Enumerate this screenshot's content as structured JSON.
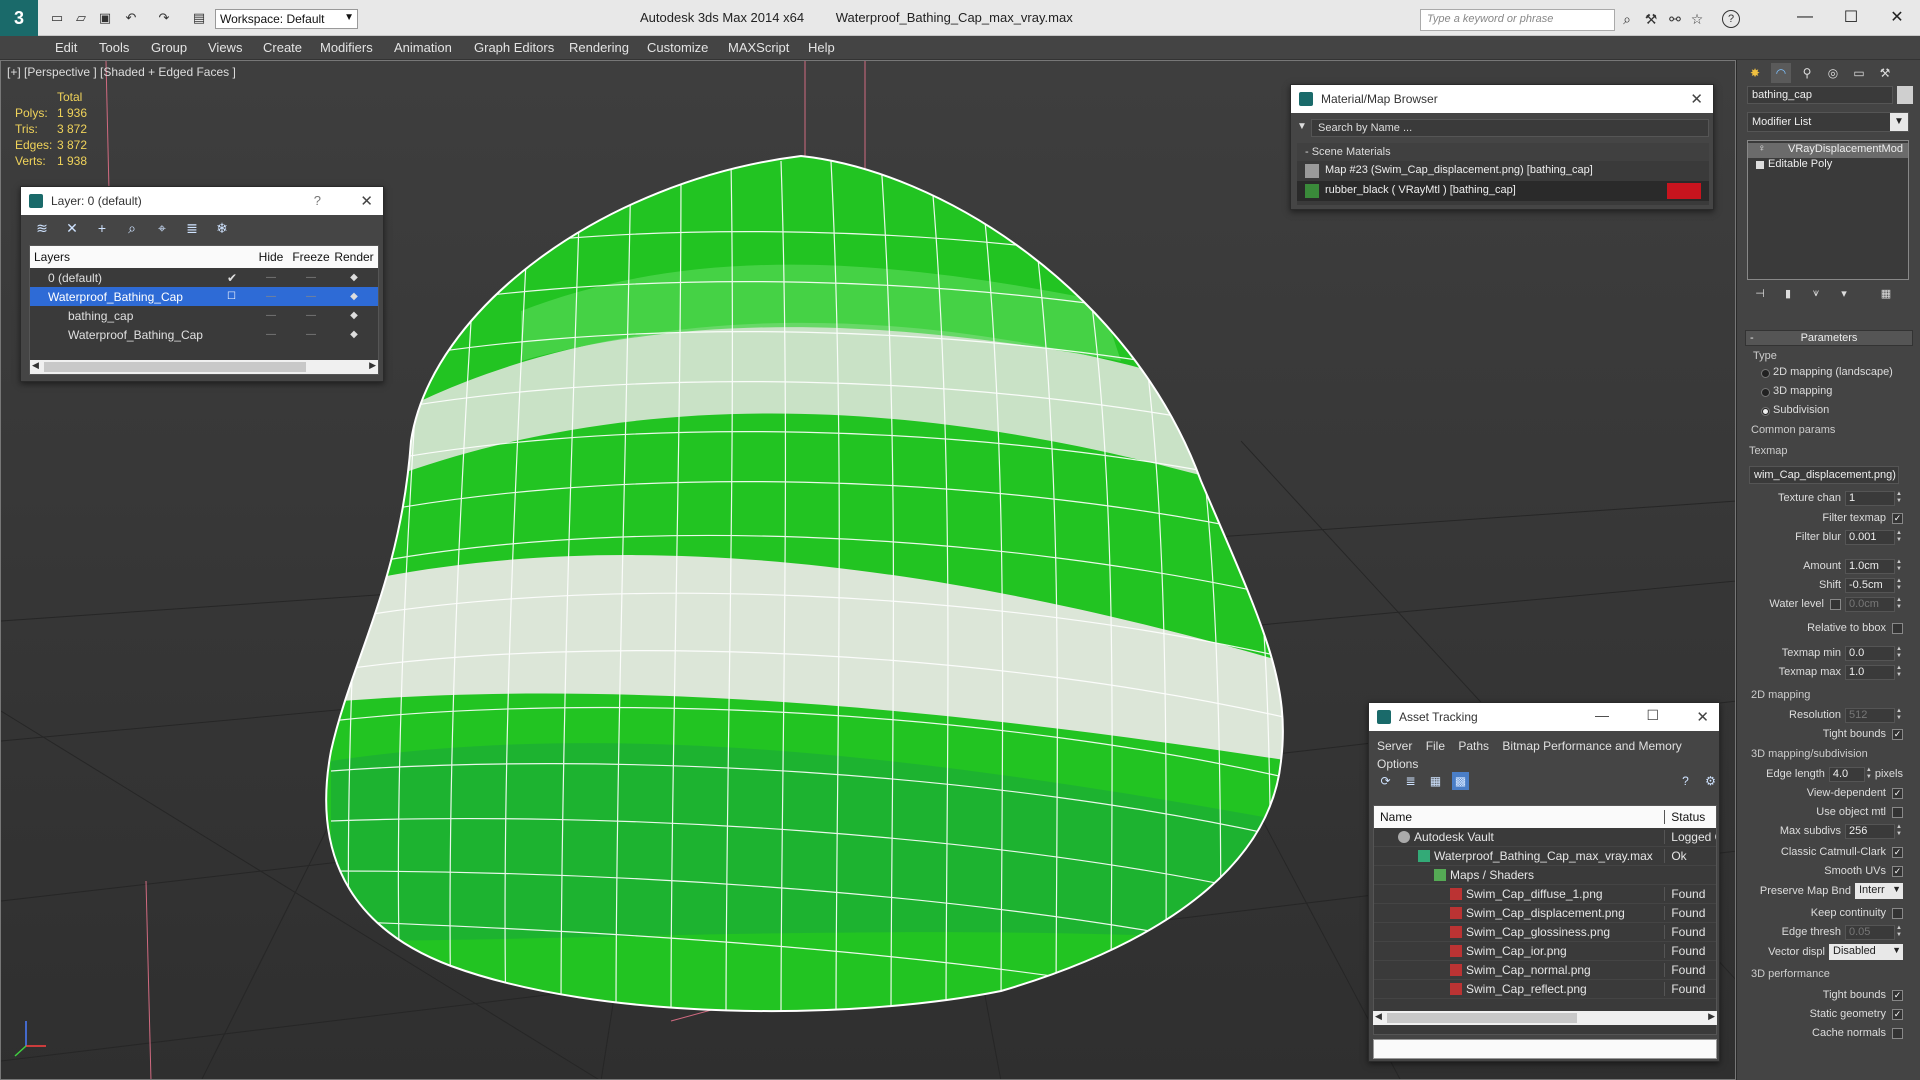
{
  "title_bar": {
    "app_name": "Autodesk 3ds Max  2014 x64",
    "file_name": "Waterproof_Bathing_Cap_max_vray.max",
    "workspace_label": "Workspace: Default",
    "search_placeholder": "Type a keyword or phrase",
    "help_label": "?"
  },
  "menu": [
    "Edit",
    "Tools",
    "Group",
    "Views",
    "Create",
    "Modifiers",
    "Animation",
    "Graph Editors",
    "Rendering",
    "Customize",
    "MAXScript",
    "Help"
  ],
  "viewport": {
    "label": "[+] [Perspective ] [Shaded + Edged Faces ]",
    "stats": {
      "header": "Total",
      "rows": [
        {
          "k": "Polys:",
          "v": "1 936"
        },
        {
          "k": "Tris:",
          "v": "3 872"
        },
        {
          "k": "Edges:",
          "v": "3 872"
        },
        {
          "k": "Verts:",
          "v": "1 938"
        }
      ]
    },
    "cap_colors": {
      "green": "#22cc22",
      "white": "#dde8dd",
      "wire": "#ffffff"
    }
  },
  "layer_panel": {
    "title": "Layer: 0 (default)",
    "help": "?",
    "columns": [
      "Layers",
      "Hide",
      "Freeze",
      "Render"
    ],
    "rows": [
      {
        "name": "0 (default)",
        "current": "✔"
      },
      {
        "name": "Waterproof_Bathing_Cap",
        "current": ""
      },
      {
        "name": "bathing_cap",
        "current": ""
      },
      {
        "name": "Waterproof_Bathing_Cap",
        "current": ""
      }
    ]
  },
  "material_browser": {
    "title": "Material/Map Browser",
    "search_placeholder": "Search by Name ...",
    "group": "- Scene Materials",
    "items": [
      "Map #23 (Swim_Cap_displacement.png)  [bathing_cap]",
      "rubber_black  ( VRayMtl )  [bathing_cap]"
    ]
  },
  "asset_tracking": {
    "title": "Asset Tracking",
    "menu_row1": [
      "Server",
      "File",
      "Paths",
      "Bitmap Performance and Memory"
    ],
    "menu_row2": [
      "Options"
    ],
    "columns": [
      "Name",
      "Status"
    ],
    "rows": [
      {
        "name": "Autodesk Vault",
        "status": "Logged C",
        "icon": "vault"
      },
      {
        "name": "Waterproof_Bathing_Cap_max_vray.max",
        "status": "Ok",
        "icon": "max"
      },
      {
        "name": "Maps / Shaders",
        "status": "",
        "icon": "folder"
      },
      {
        "name": "Swim_Cap_diffuse_1.png",
        "status": "Found",
        "icon": "png"
      },
      {
        "name": "Swim_Cap_displacement.png",
        "status": "Found",
        "icon": "png"
      },
      {
        "name": "Swim_Cap_glossiness.png",
        "status": "Found",
        "icon": "png"
      },
      {
        "name": "Swim_Cap_ior.png",
        "status": "Found",
        "icon": "png"
      },
      {
        "name": "Swim_Cap_normal.png",
        "status": "Found",
        "icon": "png"
      },
      {
        "name": "Swim_Cap_reflect.png",
        "status": "Found",
        "icon": "png"
      }
    ]
  },
  "command_panel": {
    "object_name": "bathing_cap",
    "modifier_list": "Modifier List",
    "stack": [
      "VRayDisplacementMod",
      "Editable Poly"
    ],
    "parameters_title": "Parameters",
    "type_label": "Type",
    "type_options": [
      "2D mapping (landscape)",
      "3D mapping",
      "Subdivision"
    ],
    "common_params": "Common params",
    "texmap_label": "Texmap",
    "texmap_value": "wim_Cap_displacement.png)",
    "texture_chan_label": "Texture chan",
    "texture_chan_value": "1",
    "filter_texmap_label": "Filter texmap",
    "filter_blur_label": "Filter blur",
    "filter_blur_value": "0.001",
    "amount_label": "Amount",
    "amount_value": "1.0cm",
    "shift_label": "Shift",
    "shift_value": "-0.5cm",
    "water_level_label": "Water level",
    "water_level_value": "0.0cm",
    "relative_bbox_label": "Relative to bbox",
    "texmap_min_label": "Texmap min",
    "texmap_min_value": "0.0",
    "texmap_max_label": "Texmap max",
    "texmap_max_value": "1.0",
    "mapping2d_title": "2D mapping",
    "resolution_label": "Resolution",
    "resolution_value": "512",
    "tight_bounds_label": "Tight bounds",
    "mapping3d_title": "3D mapping/subdivision",
    "edge_length_label": "Edge length",
    "edge_length_value": "4.0",
    "pixels_label": "pixels",
    "view_dependent_label": "View-dependent",
    "use_object_mtl_label": "Use object mtl",
    "max_subdivs_label": "Max subdivs",
    "max_subdivs_value": "256",
    "catmull_label": "Classic Catmull-Clark",
    "smooth_uvs_label": "Smooth UVs",
    "preserve_map_label": "Preserve Map Bnd",
    "preserve_map_value": "Interr",
    "keep_continuity_label": "Keep continuity",
    "edge_thresh_label": "Edge thresh",
    "edge_thresh_value": "0.05",
    "vector_displ_label": "Vector displ",
    "vector_displ_value": "Disabled",
    "perf3d_title": "3D performance",
    "tight_bounds2_label": "Tight bounds",
    "static_geometry_label": "Static geometry",
    "cache_normals_label": "Cache normals"
  }
}
